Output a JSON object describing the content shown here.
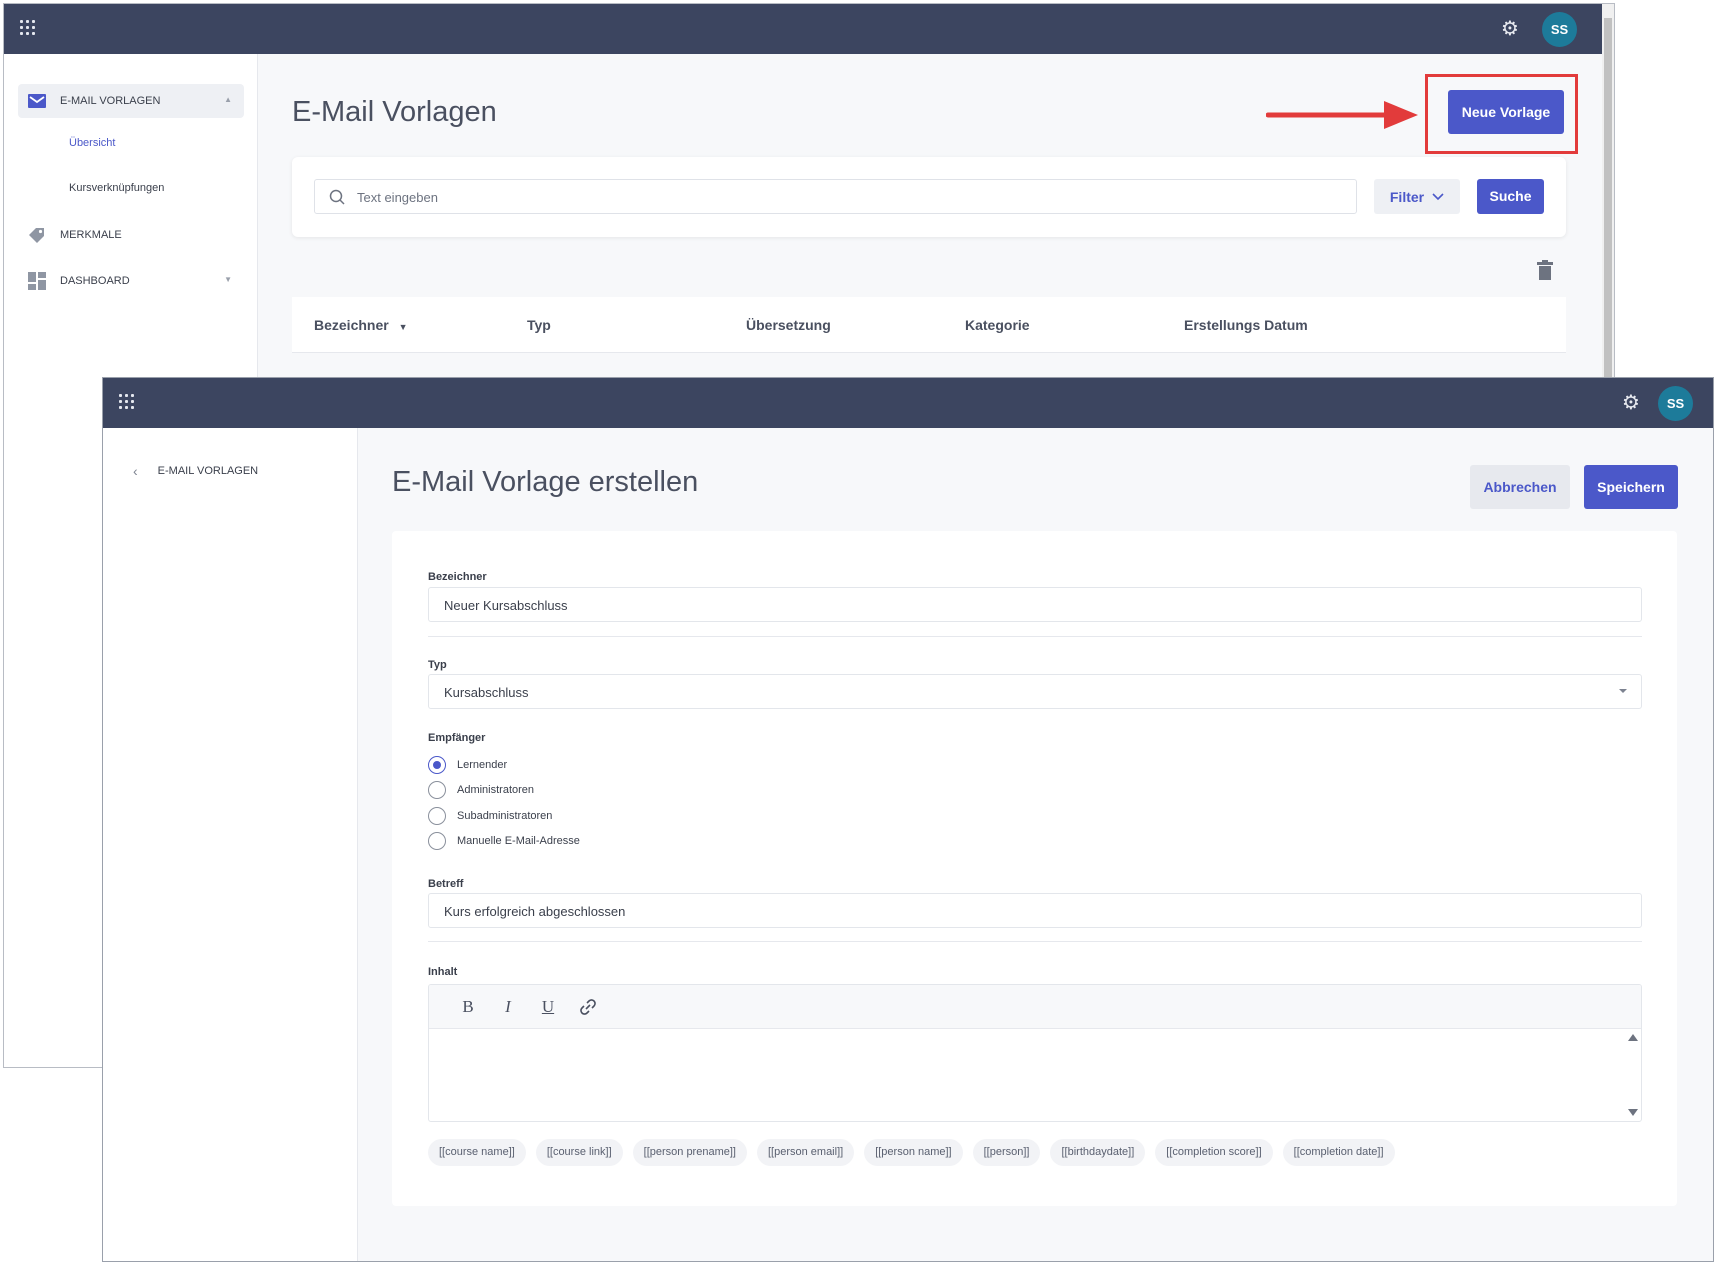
{
  "back_window": {
    "user_initials": "SS",
    "sidebar": {
      "sections": [
        {
          "label": "E-MAIL VORLAGEN",
          "icon": "envelope-icon",
          "expanded": true,
          "items": [
            {
              "label": "Übersicht",
              "active": true
            },
            {
              "label": "Kursverknüpfungen",
              "active": false
            }
          ]
        },
        {
          "label": "MERKMALE",
          "icon": "tag-icon",
          "expanded": false,
          "items": []
        },
        {
          "label": "DASHBOARD",
          "icon": "dashboard-icon",
          "expanded": false,
          "items": []
        }
      ]
    },
    "title": "E-Mail Vorlagen",
    "new_button": "Neue Vorlage",
    "search": {
      "placeholder": "Text eingeben",
      "filter_label": "Filter",
      "search_label": "Suche"
    },
    "table": {
      "columns": [
        "Bezeichner",
        "Typ",
        "Übersetzung",
        "Kategorie",
        "Erstellungs Datum"
      ],
      "sort_column": "Bezeichner"
    }
  },
  "front_window": {
    "user_initials": "SS",
    "back_link": "E-MAIL VORLAGEN",
    "title": "E-Mail Vorlage erstellen",
    "cancel_label": "Abbrechen",
    "save_label": "Speichern",
    "form": {
      "name": {
        "label": "Bezeichner",
        "value": "Neuer Kursabschluss"
      },
      "type": {
        "label": "Typ",
        "value": "Kursabschluss"
      },
      "recipient": {
        "label": "Empfänger",
        "options": [
          "Lernender",
          "Administratoren",
          "Subadministratoren",
          "Manuelle E-Mail-Adresse"
        ],
        "selected": "Lernender"
      },
      "subject": {
        "label": "Betreff",
        "value": "Kurs erfolgreich abgeschlossen"
      },
      "content": {
        "label": "Inhalt",
        "toolbar": [
          {
            "name": "bold",
            "glyph": "B"
          },
          {
            "name": "italic",
            "glyph": "I"
          },
          {
            "name": "underline",
            "glyph": "U"
          },
          {
            "name": "link",
            "glyph": "🔗"
          }
        ],
        "value": ""
      },
      "placeholders": [
        "[[course name]]",
        "[[course link]]",
        "[[person prename]]",
        "[[person email]]",
        "[[person name]]",
        "[[person]]",
        "[[birthdaydate]]",
        "[[completion score]]",
        "[[completion date]]"
      ]
    }
  },
  "colors": {
    "topbar": "#3c4560",
    "accent": "#4b58c9",
    "avatar": "#1d7b9a",
    "annotation": "#e23b3b"
  }
}
